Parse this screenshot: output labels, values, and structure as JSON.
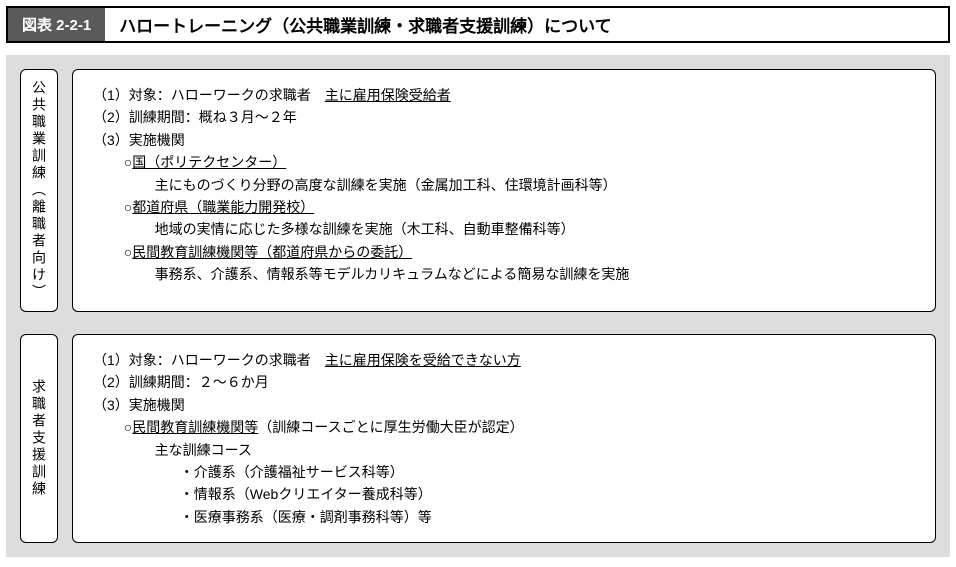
{
  "titleBar": {
    "tag": "図表 2-2-1",
    "text": "ハロートレーニング（公共職業訓練・求職者支援訓練）について"
  },
  "sections": [
    {
      "sideLabel": "公共職業訓練（離職者向け）",
      "lines": [
        {
          "t": "row1",
          "num": "（1）",
          "pre": "対象：ハローワークの求職者　",
          "ul": "主に雇用保険受給者"
        },
        {
          "t": "plain",
          "text": "（2）訓練期間：概ね３月～２年"
        },
        {
          "t": "plain",
          "text": "（3）実施機関"
        },
        {
          "t": "sub",
          "pre": "○",
          "ul": "国（ポリテクセンター）"
        },
        {
          "t": "desc",
          "text": "主にものづくり分野の高度な訓練を実施（金属加工科、住環境計画科等）"
        },
        {
          "t": "sub",
          "pre": "○",
          "ul": "都道府県（職業能力開発校）"
        },
        {
          "t": "desc",
          "text": "地域の実情に応じた多様な訓練を実施（木工科、自動車整備科等）"
        },
        {
          "t": "sub",
          "pre": "○",
          "ul": "民間教育訓練機関等（都道府県からの委託）"
        },
        {
          "t": "desc",
          "text": "事務系、介護系、情報系等モデルカリキュラムなどによる簡易な訓練を実施"
        }
      ]
    },
    {
      "sideLabel": "求職者支援訓練",
      "lines": [
        {
          "t": "row1",
          "num": "（1）",
          "pre": "対象：ハローワークの求職者　",
          "ul": "主に雇用保険を受給できない方"
        },
        {
          "t": "plain",
          "text": "（2）訓練期間：２～６か月"
        },
        {
          "t": "plain",
          "text": "（3）実施機関"
        },
        {
          "t": "submix",
          "pre": "○",
          "ul": "民間教育訓練機関等",
          "post": "（訓練コースごとに厚生労働大臣が認定）"
        },
        {
          "t": "desc",
          "text": "主な訓練コース"
        },
        {
          "t": "bullet",
          "text": "・介護系（介護福祉サービス科等）"
        },
        {
          "t": "bullet",
          "text": "・情報系（Webクリエイター養成科等）"
        },
        {
          "t": "bullet",
          "text": "・医療事務系（医療・調剤事務科等）等"
        }
      ]
    }
  ]
}
